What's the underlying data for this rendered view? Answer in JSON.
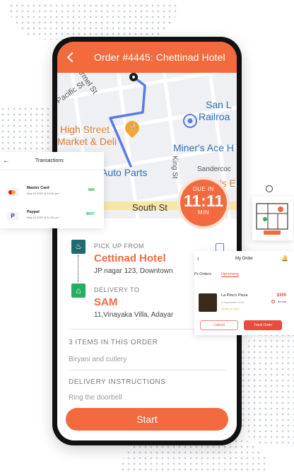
{
  "header": {
    "title": "Order #4445: Chettinad Hotel"
  },
  "map": {
    "street_labels": [
      "armel St",
      "Pacific St",
      "San L",
      "Railroa",
      "High Street",
      "Market & Deli",
      "Miner's Ace H",
      "King St",
      "Sandercoc",
      "Auto Parts",
      "Fatte's E",
      "South St"
    ]
  },
  "due": {
    "top": "DUE IN",
    "time": "11:11",
    "unit": "MIN"
  },
  "pickup": {
    "title": "PICK UP FROM",
    "name": "Cettinad Hotel",
    "address": "JP nagar 123, Downtown"
  },
  "delivery": {
    "title": "DELIVERY TO",
    "name": "SAM",
    "address": "11,Vinayaka Villa, Adayar"
  },
  "items": {
    "title": "3 ITEMS IN THIS ORDER",
    "list": "Biryani and cutlery"
  },
  "instructions": {
    "title": "DELIVERY INSTRUCTIONS",
    "text": "Ring the doorbell"
  },
  "start_label": "Start",
  "transactions": {
    "title": "Transactions",
    "rows": [
      {
        "name": "Master Card",
        "date": "May 24 2022 at 10:00 pm",
        "amount": "$80"
      },
      {
        "name": "Paypal",
        "date": "May 24 2022 at 11:00 pm",
        "amount": "$557"
      }
    ]
  },
  "my_order": {
    "title": "My Order",
    "tabs": [
      "Pr-Orders",
      "Upcoming"
    ],
    "item": {
      "name": "La Pino'z Pizza",
      "price": "$300",
      "date": "2 September 2021",
      "time": "34 min",
      "status": "Order on Way"
    },
    "cancel_label": "Cancel",
    "track_label": "Track Order"
  },
  "colors": {
    "accent": "#f26a3e",
    "route": "#5b7be6",
    "green": "#27ae60",
    "teal": "#1b6b6f"
  },
  "icons": [
    "back-chevron-icon",
    "map-pin-icon",
    "cart-icon",
    "map-fold-icon",
    "chef-hat-icon",
    "home-icon",
    "bell-icon",
    "clock-icon",
    "location-user-icon"
  ]
}
